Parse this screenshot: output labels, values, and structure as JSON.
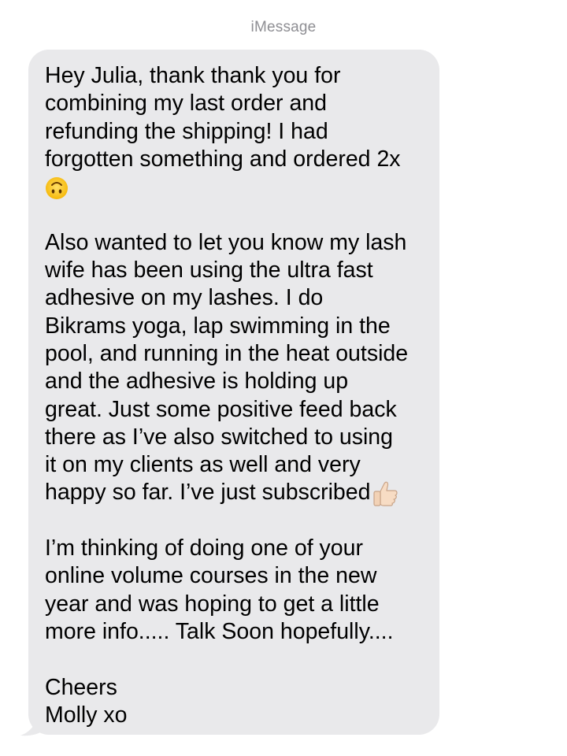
{
  "header": {
    "service": "iMessage"
  },
  "message": {
    "sender": "incoming",
    "bubble_color": "#e9e9eb",
    "paragraphs": [
      {
        "lines": [
          "Hey Julia,  thank thank you for",
          "combining my last order and",
          "refunding the shipping!  I had",
          "forgotten something and ordered 2x"
        ],
        "trailing_emoji": "upside-down-face-icon"
      },
      {
        "lines": [
          "Also wanted to let you know my lash",
          "wife has been using the ultra fast",
          "adhesive on my lashes.  I do",
          "Bikrams yoga,  lap swimming in the",
          "pool, and running in the heat outside",
          "and the adhesive is holding up",
          "great.  Just some positive feed back",
          "there as I’ve also switched to using",
          "it on my clients as well and very",
          "happy so far.  I’ve just subscribed"
        ],
        "trailing_emoji": "thumbs-up-icon"
      },
      {
        "lines": [
          "I’m thinking of doing one of your",
          "online volume courses in the new",
          "year and was hoping to get a little",
          "more info.....  Talk Soon hopefully...."
        ]
      },
      {
        "lines": [
          "Cheers",
          "Molly xo"
        ]
      }
    ]
  }
}
